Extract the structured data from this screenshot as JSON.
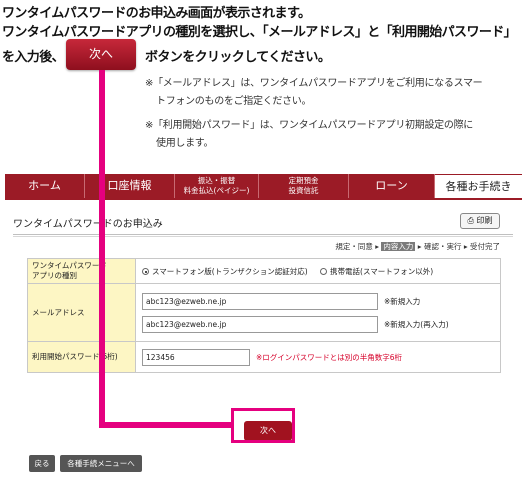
{
  "instructions": {
    "line1": "ワンタイムパスワードのお申込み画面が表示されます。",
    "line2": "ワンタイムパスワードアプリの種別を選択し、「メールアドレス」と「利用開始パスワード」",
    "line3_prefix": "を入力後、",
    "line3_button": "次へ",
    "line3_suffix": "ボタンをクリックしてください。"
  },
  "notes": {
    "note1_line1": "※「メールアドレス」は、ワンタイムパスワードアプリをご利用になるスマー",
    "note1_line2": "トフォンのものをご指定ください。",
    "note2_line1": "※「利用開始パスワード」は、ワンタイムパスワードアプリ初期設定の際に",
    "note2_line2": "使用します。"
  },
  "nav": {
    "home": "ホーム",
    "account": "口座情報",
    "transfer_line1": "振込・振替",
    "transfer_line2": "料金払込(ペイジー)",
    "deposit_line1": "定期預金",
    "deposit_line2": "投資信託",
    "loan": "ローン",
    "procedures": "各種お手続き"
  },
  "page": {
    "title": "ワンタイムパスワードのお申込み",
    "print": "印刷"
  },
  "steps": {
    "step1": "規定・同意",
    "step2": "内容入力",
    "step3": "確認・実行",
    "step4": "受付完了",
    "separator": " ▸ "
  },
  "form": {
    "app_type_label_line1": "ワンタイムパスワード",
    "app_type_label_line2": "アプリの種別",
    "option_smartphone": "スマートフォン版(トランザクション認証対応)",
    "option_mobile": "携帯電話(スマートフォン以外)",
    "selected_option": "スマートフォン版(トランザクション認証対応)",
    "email_label": "メールアドレス",
    "email_value": "abc123@ezweb.ne.jp",
    "email_hint": "※新規入力",
    "email_confirm_value": "abc123@ezweb.ne.jp",
    "email_confirm_hint": "※新規入力(再入力)",
    "password_label": "利用開始パスワード(6桁)",
    "password_value": "123456",
    "password_hint": "※ログインパスワードとは別の半角数字6桁"
  },
  "buttons": {
    "next": "次へ",
    "back": "戻る",
    "menu": "各種手続メニューへ"
  },
  "colors": {
    "brand": "#9b1b26",
    "highlight": "#e5007f",
    "label_bg": "#fdf6c4"
  }
}
